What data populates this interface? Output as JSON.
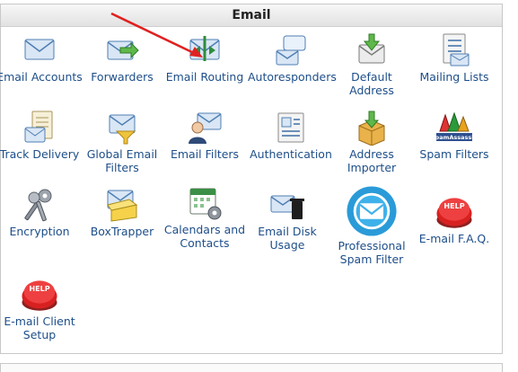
{
  "section": {
    "title": "Email"
  },
  "items": [
    {
      "id": "email-accounts",
      "label": "Email Accounts",
      "icon": "envelope-icon"
    },
    {
      "id": "forwarders",
      "label": "Forwarders",
      "icon": "forward-envelope-icon"
    },
    {
      "id": "email-routing",
      "label": "Email Routing",
      "icon": "routing-envelope-icon"
    },
    {
      "id": "autoresponders",
      "label": "Autoresponders",
      "icon": "autoresponder-icon"
    },
    {
      "id": "default-address",
      "label": "Default Address",
      "icon": "default-address-icon"
    },
    {
      "id": "mailing-lists",
      "label": "Mailing Lists",
      "icon": "mailing-list-icon"
    },
    {
      "id": "track-delivery",
      "label": "Track Delivery",
      "icon": "track-delivery-icon"
    },
    {
      "id": "global-email-filters",
      "label": "Global Email Filters",
      "icon": "global-filter-icon"
    },
    {
      "id": "email-filters",
      "label": "Email Filters",
      "icon": "user-filter-icon"
    },
    {
      "id": "authentication",
      "label": "Authentication",
      "icon": "authentication-icon"
    },
    {
      "id": "address-importer",
      "label": "Address Importer",
      "icon": "importer-box-icon"
    },
    {
      "id": "spam-filters",
      "label": "Spam Filters",
      "icon": "spamassassin-logo-icon",
      "logo_text": "SpamAssassin"
    },
    {
      "id": "encryption",
      "label": "Encryption",
      "icon": "keys-icon"
    },
    {
      "id": "boxtrapper",
      "label": "BoxTrapper",
      "icon": "boxtrapper-icon"
    },
    {
      "id": "calendars-and-contacts",
      "label": "Calendars and Contacts",
      "icon": "calendar-gear-icon"
    },
    {
      "id": "email-disk-usage",
      "label": "Email Disk Usage",
      "icon": "disk-usage-trash-icon"
    },
    {
      "id": "professional-spam-filter",
      "label": "Professional Spam Filter",
      "icon": "spam-filter-round-icon"
    },
    {
      "id": "email-faq",
      "label": "E-mail F.A.Q.",
      "icon": "help-button-icon",
      "logo_text": "HELP"
    },
    {
      "id": "email-client-setup",
      "label": "E-mail Client Setup",
      "icon": "help-button-icon",
      "logo_text": "HELP"
    }
  ],
  "colors": {
    "link": "#1d4e89",
    "header_bg": "#e8e8e8",
    "arrow": "#e02020",
    "help_red": "#d82020",
    "envelope_blue": "#7ea6cf"
  }
}
